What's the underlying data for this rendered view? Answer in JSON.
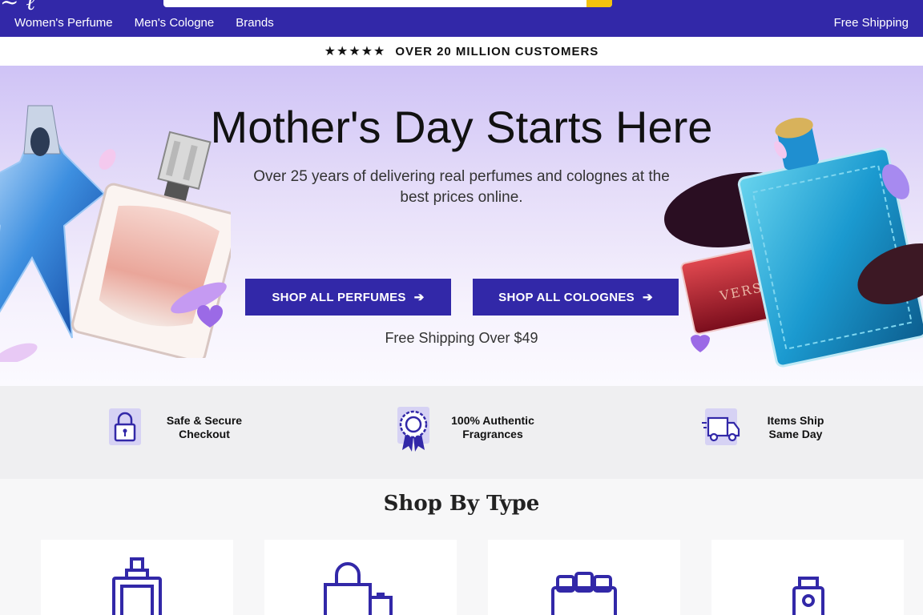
{
  "header": {
    "nav": [
      "Women's Perfume",
      "Men's Cologne",
      "Brands"
    ],
    "free_shipping_link": "Free Shipping"
  },
  "trust_strip": {
    "stars": "★★★★★",
    "text": "OVER 20 MILLION CUSTOMERS"
  },
  "hero": {
    "title": "Mother's Day Starts Here",
    "subtitle": "Over 25 years of delivering real perfumes and colognes at the best prices online.",
    "buttons": [
      {
        "label": "SHOP ALL PERFUMES",
        "arrow": "➔"
      },
      {
        "label": "SHOP ALL COLOGNES",
        "arrow": "➔"
      }
    ],
    "shipping_note": "Free Shipping Over $49"
  },
  "features": [
    {
      "icon": "padlock-icon",
      "text": "Safe & Secure Checkout"
    },
    {
      "icon": "award-ribbon-icon",
      "text": "100% Authentic Fragrances"
    },
    {
      "icon": "delivery-truck-icon",
      "text": "Items Ship Same Day"
    }
  ],
  "shop_by_type": {
    "title": "Shop By Type",
    "cards": [
      {
        "icon": "perfume-bottle-icon"
      },
      {
        "icon": "shopping-bag-icon"
      },
      {
        "icon": "gift-box-icon"
      },
      {
        "icon": "spray-bottle-icon"
      }
    ]
  },
  "colors": {
    "brand": "#3228a8",
    "accent": "#f4c20d",
    "hero_top": "#cfc3f6"
  }
}
